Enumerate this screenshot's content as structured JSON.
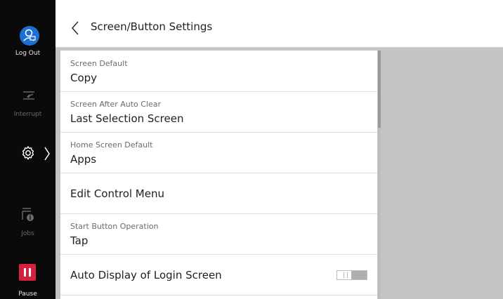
{
  "sidebar": {
    "logout_label": "Log Out",
    "interrupt_label": "Interrupt",
    "jobs_label": "Jobs",
    "pause_label": "Pause",
    "icons": [
      "user-logout-icon",
      "interrupt-icon",
      "settings-gear-icon",
      "jobs-icon",
      "pause-icon"
    ],
    "colors": {
      "logout_accent": "#1e6fd4",
      "pause_accent": "#d4213d"
    }
  },
  "header": {
    "title": "Screen/Button Settings"
  },
  "settings": [
    {
      "label": "Screen Default",
      "value": "Copy"
    },
    {
      "label": "Screen After Auto Clear",
      "value": "Last Selection Screen"
    },
    {
      "label": "Home Screen Default",
      "value": "Apps"
    },
    {
      "label": "",
      "value": "Edit Control Menu"
    },
    {
      "label": "Start Button Operation",
      "value": "Tap"
    },
    {
      "label": "",
      "value": "Auto Display of Login Screen",
      "toggle": "off"
    }
  ]
}
